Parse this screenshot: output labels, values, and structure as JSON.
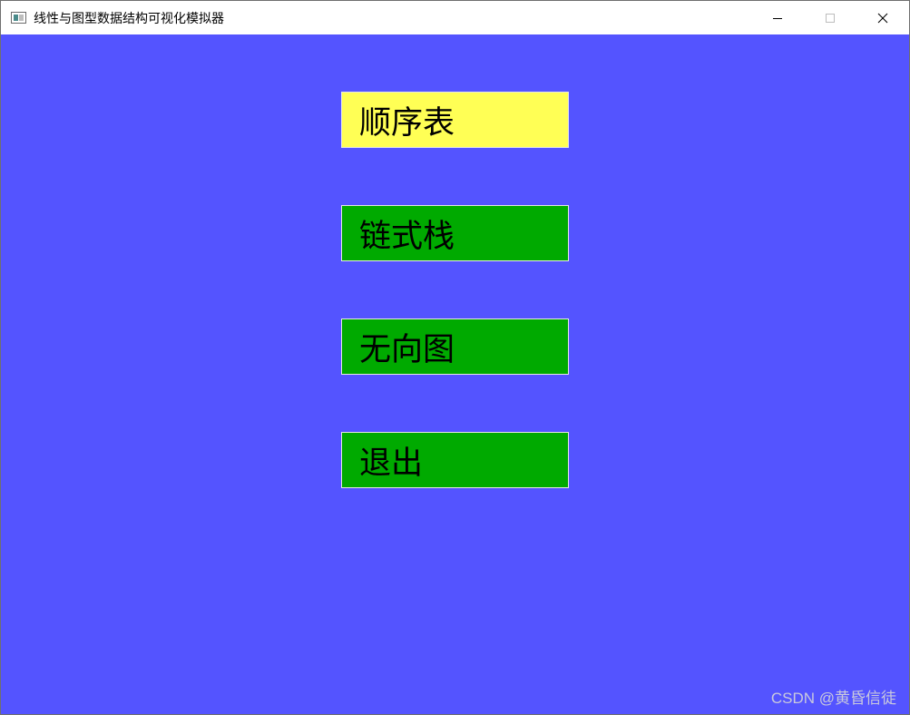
{
  "window": {
    "title": "线性与图型数据结构可视化模拟器",
    "background": "#5454ff",
    "icons": {
      "app": "app-window-icon",
      "minimize": "minimize-icon",
      "maximize": "maximize-icon",
      "close": "close-icon"
    }
  },
  "menu": {
    "items": [
      {
        "label": "顺序表",
        "color": "#ffff55"
      },
      {
        "label": "链式栈",
        "color": "#00aa00"
      },
      {
        "label": "无向图",
        "color": "#00aa00"
      },
      {
        "label": "退出",
        "color": "#00aa00"
      }
    ]
  },
  "watermark": {
    "text": "CSDN @黄昏信徒"
  }
}
